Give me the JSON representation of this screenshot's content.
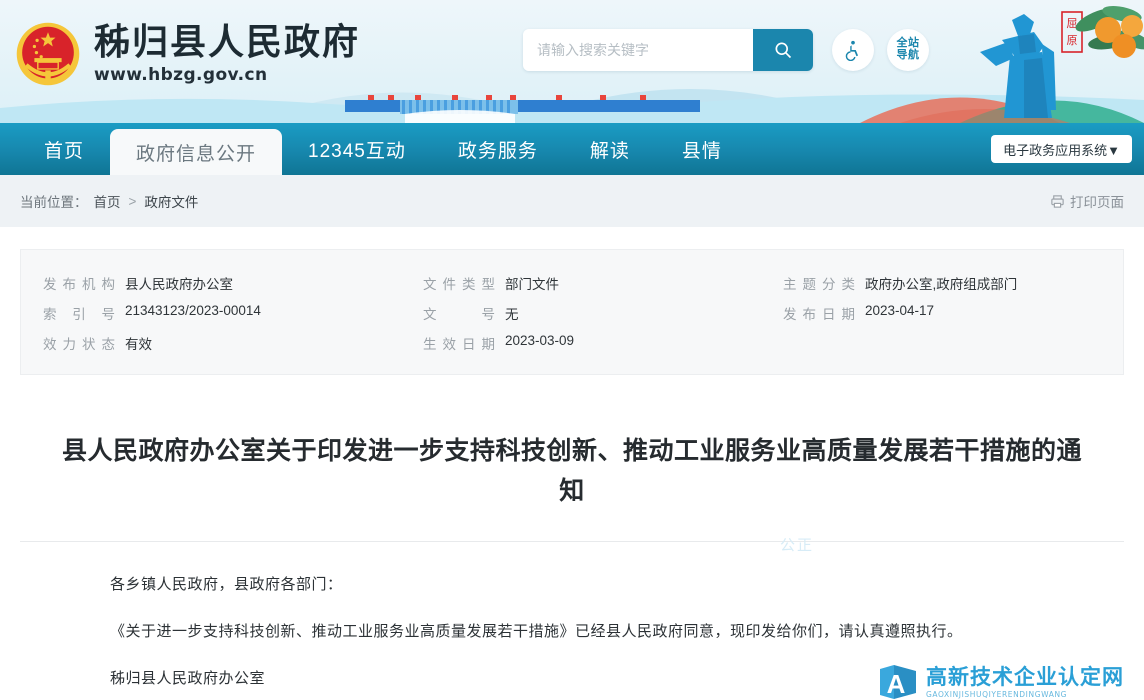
{
  "header": {
    "emblem_icon": "china-national-emblem",
    "site_title": "秭归县人民政府",
    "site_url": "www.hbzg.gov.cn",
    "search": {
      "placeholder": "请输入搜索关键字",
      "value": "",
      "button_icon": "search-icon"
    },
    "accessibility_icon": "wheelchair-accessibility-icon",
    "site_nav_line1": "全站",
    "site_nav_line2": "导航",
    "artwork": {
      "statue_label": "屈原",
      "description": "qu-yuan-statue-and-oranges-illustration"
    },
    "colors": {
      "bg_top": "#eaf4f8",
      "bg_bottom": "#daeef6",
      "search_button": "#1b86ad",
      "accent": "#1b86ad"
    }
  },
  "nav": {
    "items": [
      {
        "label": "首页",
        "active": false
      },
      {
        "label": "政府信息公开",
        "active": true
      },
      {
        "label": "12345互动",
        "active": false
      },
      {
        "label": "政务服务",
        "active": false
      },
      {
        "label": "解读",
        "active": false
      },
      {
        "label": "县情",
        "active": false
      }
    ],
    "dropdown_label": "电子政务应用系统▼",
    "colors": {
      "bar_top": "#1a9cc4",
      "bar_bottom": "#0f7594",
      "active_bg": "#f7f9fa"
    }
  },
  "breadcrumb": {
    "prefix": "当前位置：",
    "home": "首页",
    "separator": ">",
    "current": "政府文件",
    "print_label": "打印页面",
    "print_icon": "printer-icon"
  },
  "meta": {
    "rows": [
      [
        {
          "key": "发布机构",
          "value": "县人民政府办公室"
        },
        {
          "key": "文件类型",
          "value": "部门文件"
        },
        {
          "key": "主题分类",
          "value": "政府办公室,政府组成部门"
        }
      ],
      [
        {
          "key": "索引号",
          "value": "21343123/2023-00014"
        },
        {
          "key": "文号",
          "value": "无"
        },
        {
          "key": "发布日期",
          "value": "2023-04-17"
        }
      ],
      [
        {
          "key": "效力状态",
          "value": "有效"
        },
        {
          "key": "生效日期",
          "value": "2023-03-09"
        },
        {
          "key": "",
          "value": ""
        }
      ]
    ]
  },
  "document": {
    "title": "县人民政府办公室关于印发进一步支持科技创新、推动工业服务业高质量发展若干措施的通知",
    "salutation": "各乡镇人民政府，县政府各部门：",
    "paragraph1": "《关于进一步支持科技创新、推动工业服务业高质量发展若干措施》已经县人民政府同意，现印发给你们，请认真遵照执行。",
    "signature": "秭归县人民政府办公室"
  },
  "watermarks": {
    "text_mark": "公正",
    "logo_cn": "高新技术企业认定网",
    "logo_en": "GAOXINJISHUQIYERENDINGWANG",
    "logo_letter": "A",
    "logo_color": "#2a9fd6"
  }
}
